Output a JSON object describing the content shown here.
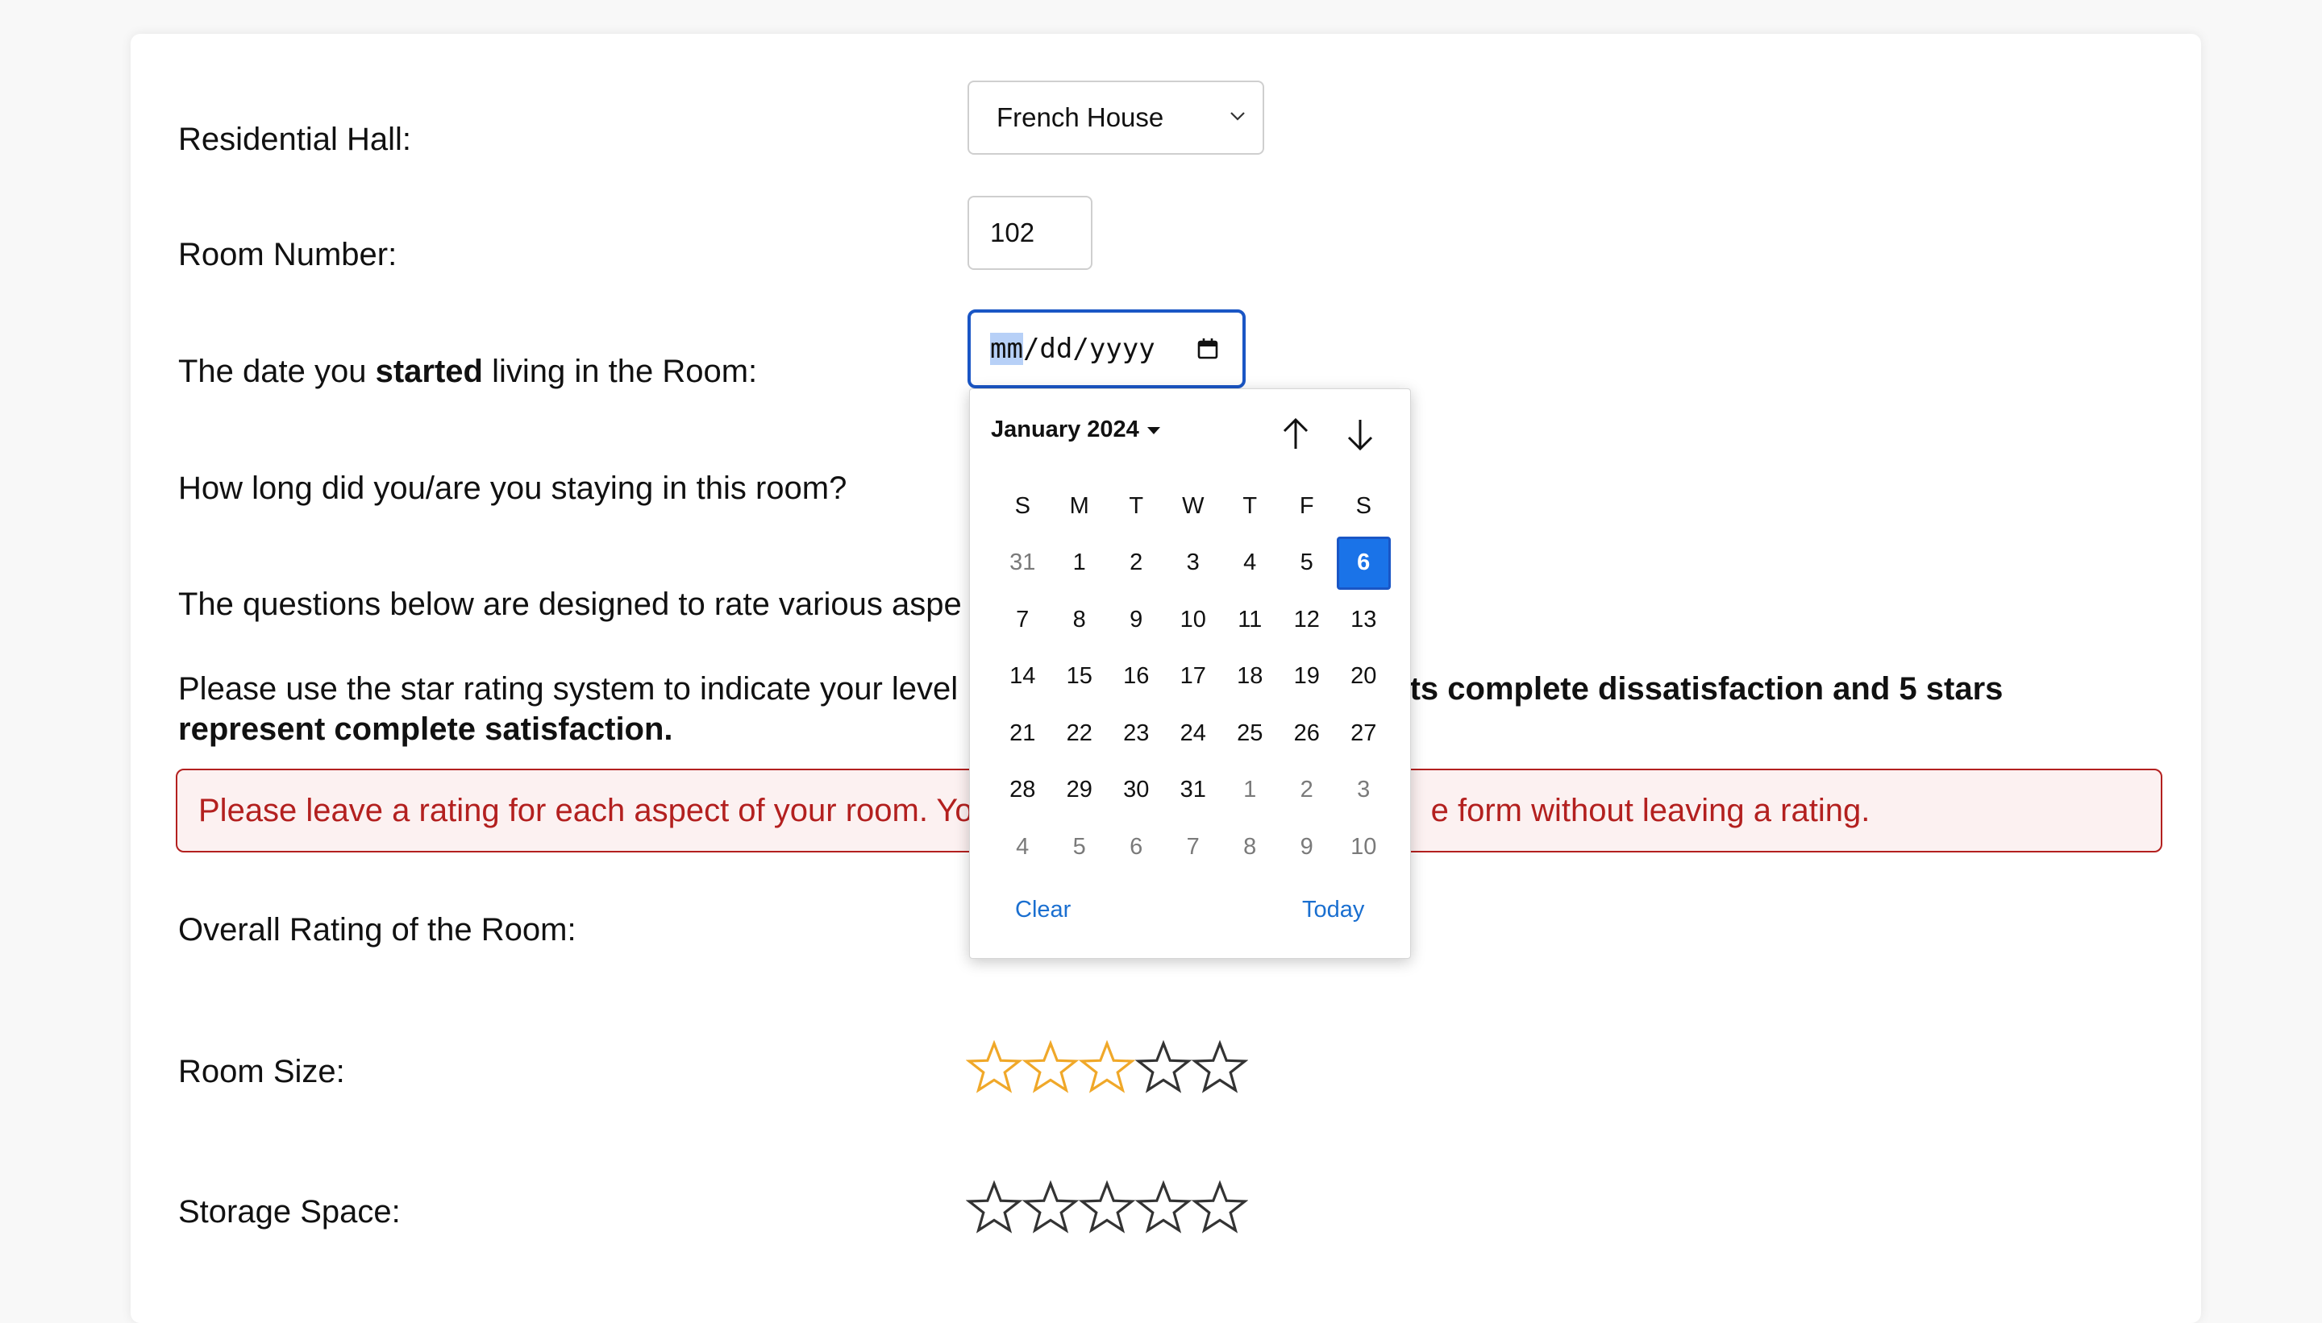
{
  "form": {
    "hall_label": "Residential Hall:",
    "hall_value": "French House",
    "room_label": "Room Number:",
    "room_value": "102",
    "date_label_pre": "The date you ",
    "date_label_bold": "started",
    "date_label_post": " living in the Room:",
    "date_placeholder_mm": "mm",
    "date_placeholder_rest": "/dd/yyyy",
    "duration_label": "How long did you/are you staying in this room?",
    "intro_text": "The questions below are designed to rate various aspe",
    "instructions_pre": "Please use the star rating system to indicate your level",
    "instructions_bold": "nts complete dissatisfaction and 5 stars represent complete satisfaction.",
    "error_pre": "Please leave a rating for each aspect of your room. Yo",
    "error_post": "e form without leaving a rating.",
    "overall_label": "Overall Rating of the Room:",
    "room_size_label": "Room Size:",
    "room_size_rating": 3,
    "storage_label": "Storage Space:",
    "storage_rating": 0,
    "star_max": 5
  },
  "datepicker": {
    "month_label": "January 2024",
    "weekdays": [
      "S",
      "M",
      "T",
      "W",
      "T",
      "F",
      "S"
    ],
    "days": [
      [
        "31",
        "1",
        "2",
        "3",
        "4",
        "5",
        "6"
      ],
      [
        "7",
        "8",
        "9",
        "10",
        "11",
        "12",
        "13"
      ],
      [
        "14",
        "15",
        "16",
        "17",
        "18",
        "19",
        "20"
      ],
      [
        "21",
        "22",
        "23",
        "24",
        "25",
        "26",
        "27"
      ],
      [
        "28",
        "29",
        "30",
        "31",
        "1",
        "2",
        "3"
      ],
      [
        "4",
        "5",
        "6",
        "7",
        "8",
        "9",
        "10"
      ]
    ],
    "selected_day": "6",
    "clear_label": "Clear",
    "today_label": "Today"
  },
  "colors": {
    "accent_blue": "#1a73e8",
    "star_gold": "#f0a829",
    "star_outline": "#333333",
    "error_red": "#b3201f"
  }
}
